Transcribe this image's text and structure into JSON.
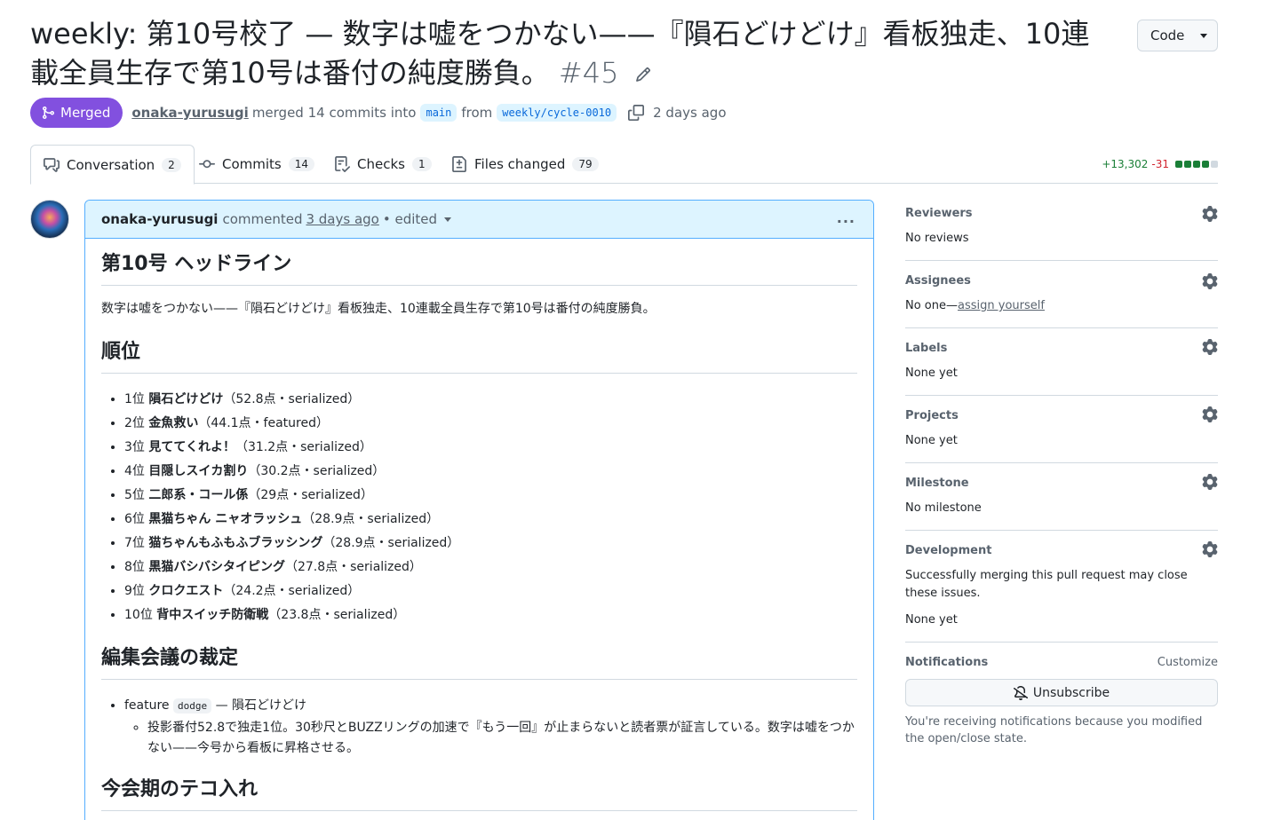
{
  "pr": {
    "title": "weekly: 第10号校了 — 数字は嘘をつかない——『隕石どけどけ』看板独走、10連載全員生存で第10号は番付の純度勝負。",
    "number": "#45",
    "code_button": "Code",
    "status": "Merged",
    "author": "onaka-yurusugi",
    "merge_text": "merged 14 commits into",
    "base_branch": "main",
    "from_text": "from",
    "head_branch": "weekly/cycle-0010",
    "time_ago": "2 days ago"
  },
  "tabs": [
    {
      "label": "Conversation",
      "count": "2",
      "icon": "comment-discussion-icon"
    },
    {
      "label": "Commits",
      "count": "14",
      "icon": "git-commit-icon"
    },
    {
      "label": "Checks",
      "count": "1",
      "icon": "checklist-icon"
    },
    {
      "label": "Files changed",
      "count": "79",
      "icon": "file-diff-icon"
    }
  ],
  "diffstat": {
    "additions": "+13,302",
    "deletions": "-31"
  },
  "comment": {
    "author": "onaka-yurusugi",
    "action": "commented",
    "time": "3 days ago",
    "edited": "• edited",
    "h1": "第10号 ヘッドライン",
    "intro": "数字は嘘をつかない——『隕石どけどけ』看板独走、10連載全員生存で第10号は番付の純度勝負。",
    "h2_rank": "順位",
    "ranking": [
      {
        "rank": "1位",
        "title": "隕石どけどけ",
        "detail": "（52.8点・serialized）"
      },
      {
        "rank": "2位",
        "title": "金魚救い",
        "detail": "（44.1点・featured）"
      },
      {
        "rank": "3位",
        "title": "見ててくれよ！",
        "detail": "（31.2点・serialized）"
      },
      {
        "rank": "4位",
        "title": "目隠しスイカ割り",
        "detail": "（30.2点・serialized）"
      },
      {
        "rank": "5位",
        "title": "二郎系・コール係",
        "detail": "（29点・serialized）"
      },
      {
        "rank": "6位",
        "title": "黒猫ちゃん ニャオラッシュ",
        "detail": "（28.9点・serialized）"
      },
      {
        "rank": "7位",
        "title": "猫ちゃんもふもふブラッシング",
        "detail": "（28.9点・serialized）"
      },
      {
        "rank": "8位",
        "title": "黒猫バシバシタイピング",
        "detail": "（27.8点・serialized）"
      },
      {
        "rank": "9位",
        "title": "クロクエスト",
        "detail": "（24.2点・serialized）"
      },
      {
        "rank": "10位",
        "title": "背中スイッチ防衛戦",
        "detail": "（23.8点・serialized）"
      }
    ],
    "h2_decision": "編集会議の裁定",
    "decision": {
      "label": "feature",
      "code": "dodge",
      "rest": "— 隕石どけどけ",
      "note": "投影番付52.8で独走1位。30秒尺とBUZZリングの加速で『もう一回』が止まらないと読者票が証言している。数字は嘘をつかない——今号から看板に昇格させる。"
    },
    "h2_tweak": "今会期のテコ入れ"
  },
  "sidebar": {
    "reviewers": {
      "title": "Reviewers",
      "value": "No reviews"
    },
    "assignees": {
      "title": "Assignees",
      "value": "No one—",
      "link": "assign yourself"
    },
    "labels": {
      "title": "Labels",
      "value": "None yet"
    },
    "projects": {
      "title": "Projects",
      "value": "None yet"
    },
    "milestone": {
      "title": "Milestone",
      "value": "No milestone"
    },
    "development": {
      "title": "Development",
      "desc": "Successfully merging this pull request may close these issues.",
      "value": "None yet"
    },
    "notifications": {
      "title": "Notifications",
      "customize": "Customize",
      "button": "Unsubscribe",
      "note": "You're receiving notifications because you modified the open/close state."
    }
  },
  "colors": {
    "merged": "#8250df",
    "accent": "#0969da",
    "additions": "#1a7f37",
    "deletions": "#d1242f"
  }
}
